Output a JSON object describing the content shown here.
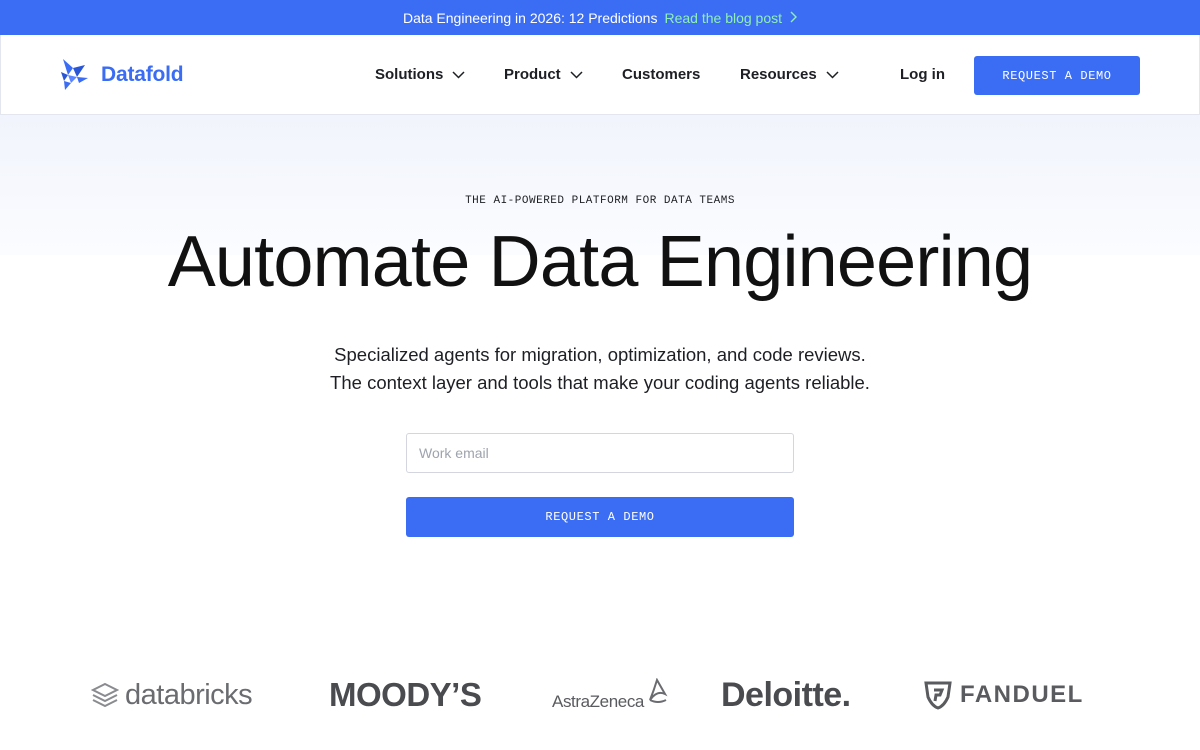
{
  "announcement": {
    "text": "Data Engineering in 2026: 12 Predictions",
    "link_label": "Read the blog post"
  },
  "nav": {
    "brand": "Datafold",
    "items": [
      {
        "label": "Solutions",
        "has_dropdown": true
      },
      {
        "label": "Product",
        "has_dropdown": true
      },
      {
        "label": "Customers",
        "has_dropdown": false
      },
      {
        "label": "Resources",
        "has_dropdown": true
      }
    ],
    "login_label": "Log in",
    "cta_label": "REQUEST A DEMO"
  },
  "hero": {
    "eyebrow": "THE AI-POWERED PLATFORM FOR DATA TEAMS",
    "headline": "Automate Data Engineering",
    "sub_line_1": "Specialized agents for migration, optimization, and code reviews.",
    "sub_line_2": "The context layer and tools that make your coding agents reliable.",
    "email_placeholder": "Work email",
    "cta_label": "REQUEST A DEMO"
  },
  "customers": {
    "databricks": "databricks",
    "moodys": "MOODY’S",
    "astrazeneca": "AstraZeneca",
    "deloitte": "Deloitte.",
    "fanduel": "FANDUEL"
  },
  "colors": {
    "brand_blue": "#3a6cf4",
    "announcement_link": "#8ff0b7",
    "text_dark": "#111111",
    "logo_gray": "#5a5b5f"
  },
  "icons": {
    "brand": "datafold-bird-icon",
    "dropdown": "chevron-down-icon",
    "link_arrow": "chevron-right-icon",
    "databricks": "databricks-stack-icon",
    "astrazeneca": "astrazeneca-swirl-icon",
    "fanduel": "fanduel-shield-icon"
  }
}
